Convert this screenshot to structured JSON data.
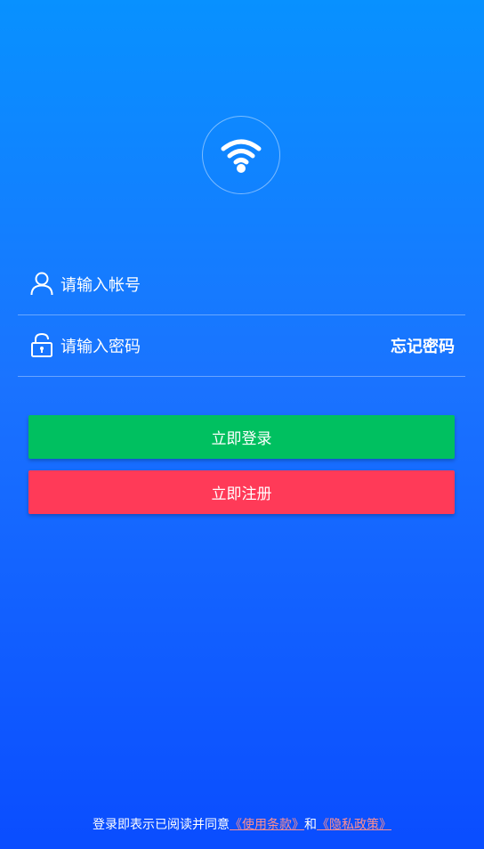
{
  "logo": {
    "icon": "wifi-icon"
  },
  "account": {
    "placeholder": "请输入帐号",
    "icon": "user-icon"
  },
  "password": {
    "placeholder": "请输入密码",
    "icon": "lock-icon",
    "forgot_label": "忘记密码"
  },
  "buttons": {
    "login_label": "立即登录",
    "register_label": "立即注册"
  },
  "agreement": {
    "prefix": "登录即表示已阅读并同意",
    "terms": "《使用条款》",
    "joiner": "和",
    "privacy": "《隐私政策》"
  },
  "colors": {
    "login": "#00c060",
    "register": "#ff3a58",
    "link": "#ff8f8f",
    "background_top": "#0891ff",
    "background_bottom": "#0a4dff"
  }
}
